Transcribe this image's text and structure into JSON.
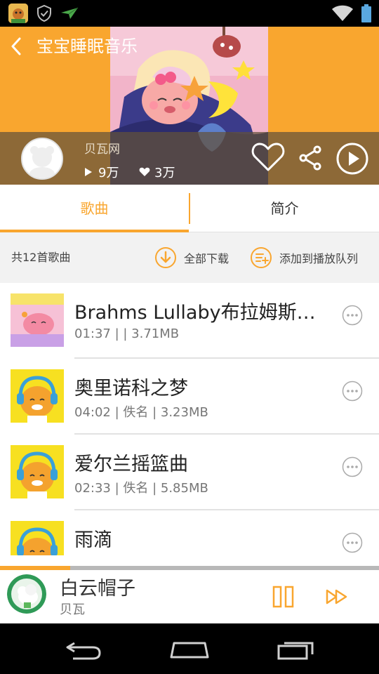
{
  "page_title": "宝宝睡眠音乐",
  "album": {
    "author": "贝瓦网",
    "play_count": "9万",
    "like_count": "3万"
  },
  "tabs": [
    {
      "label": "歌曲",
      "active": true
    },
    {
      "label": "简介",
      "active": false
    }
  ],
  "toolbar": {
    "count_text": "共12首歌曲",
    "download_all": "全部下载",
    "add_to_queue": "添加到播放队列"
  },
  "songs": [
    {
      "title": "Brahms Lullaby布拉姆斯…",
      "meta": "01:37 |  | 3.71MB"
    },
    {
      "title": "奥里诺科之梦",
      "meta": "04:02 | 佚名 | 3.23MB"
    },
    {
      "title": "爱尔兰摇篮曲",
      "meta": "02:33 | 佚名 | 5.85MB"
    },
    {
      "title": "雨滴",
      "meta": ""
    }
  ],
  "now_playing": {
    "title": "白云帽子",
    "artist": "贝瓦",
    "progress": 0.185
  },
  "colors": {
    "accent": "#f9a62f",
    "status_bar": "#000000",
    "nav_bar": "#000000"
  }
}
